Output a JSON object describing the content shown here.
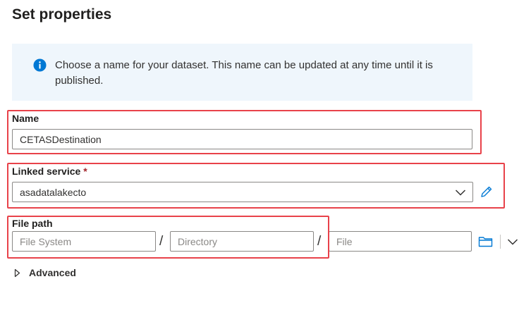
{
  "title": "Set properties",
  "info": {
    "icon": "info-icon",
    "text": "Choose a name for your dataset. This name can be updated at any time until it is published."
  },
  "name_field": {
    "label": "Name",
    "value": "CETASDestination"
  },
  "linked_service": {
    "label": "Linked service",
    "required_marker": "*",
    "selected": "asadatalakecto",
    "dropdown_icon": "chevron-down-icon",
    "edit_icon": "pencil-icon"
  },
  "file_path": {
    "label": "File path",
    "separator": "/",
    "file_system_placeholder": "File System",
    "directory_placeholder": "Directory",
    "file_placeholder": "File",
    "browse_icon": "folder-icon",
    "more_icon": "chevron-down-icon"
  },
  "advanced": {
    "label": "Advanced",
    "icon": "caret-right-icon"
  },
  "colors": {
    "accent": "#0078d4",
    "highlight": "#e8424a",
    "info_background": "#eff6fc",
    "required": "#a4262c"
  }
}
